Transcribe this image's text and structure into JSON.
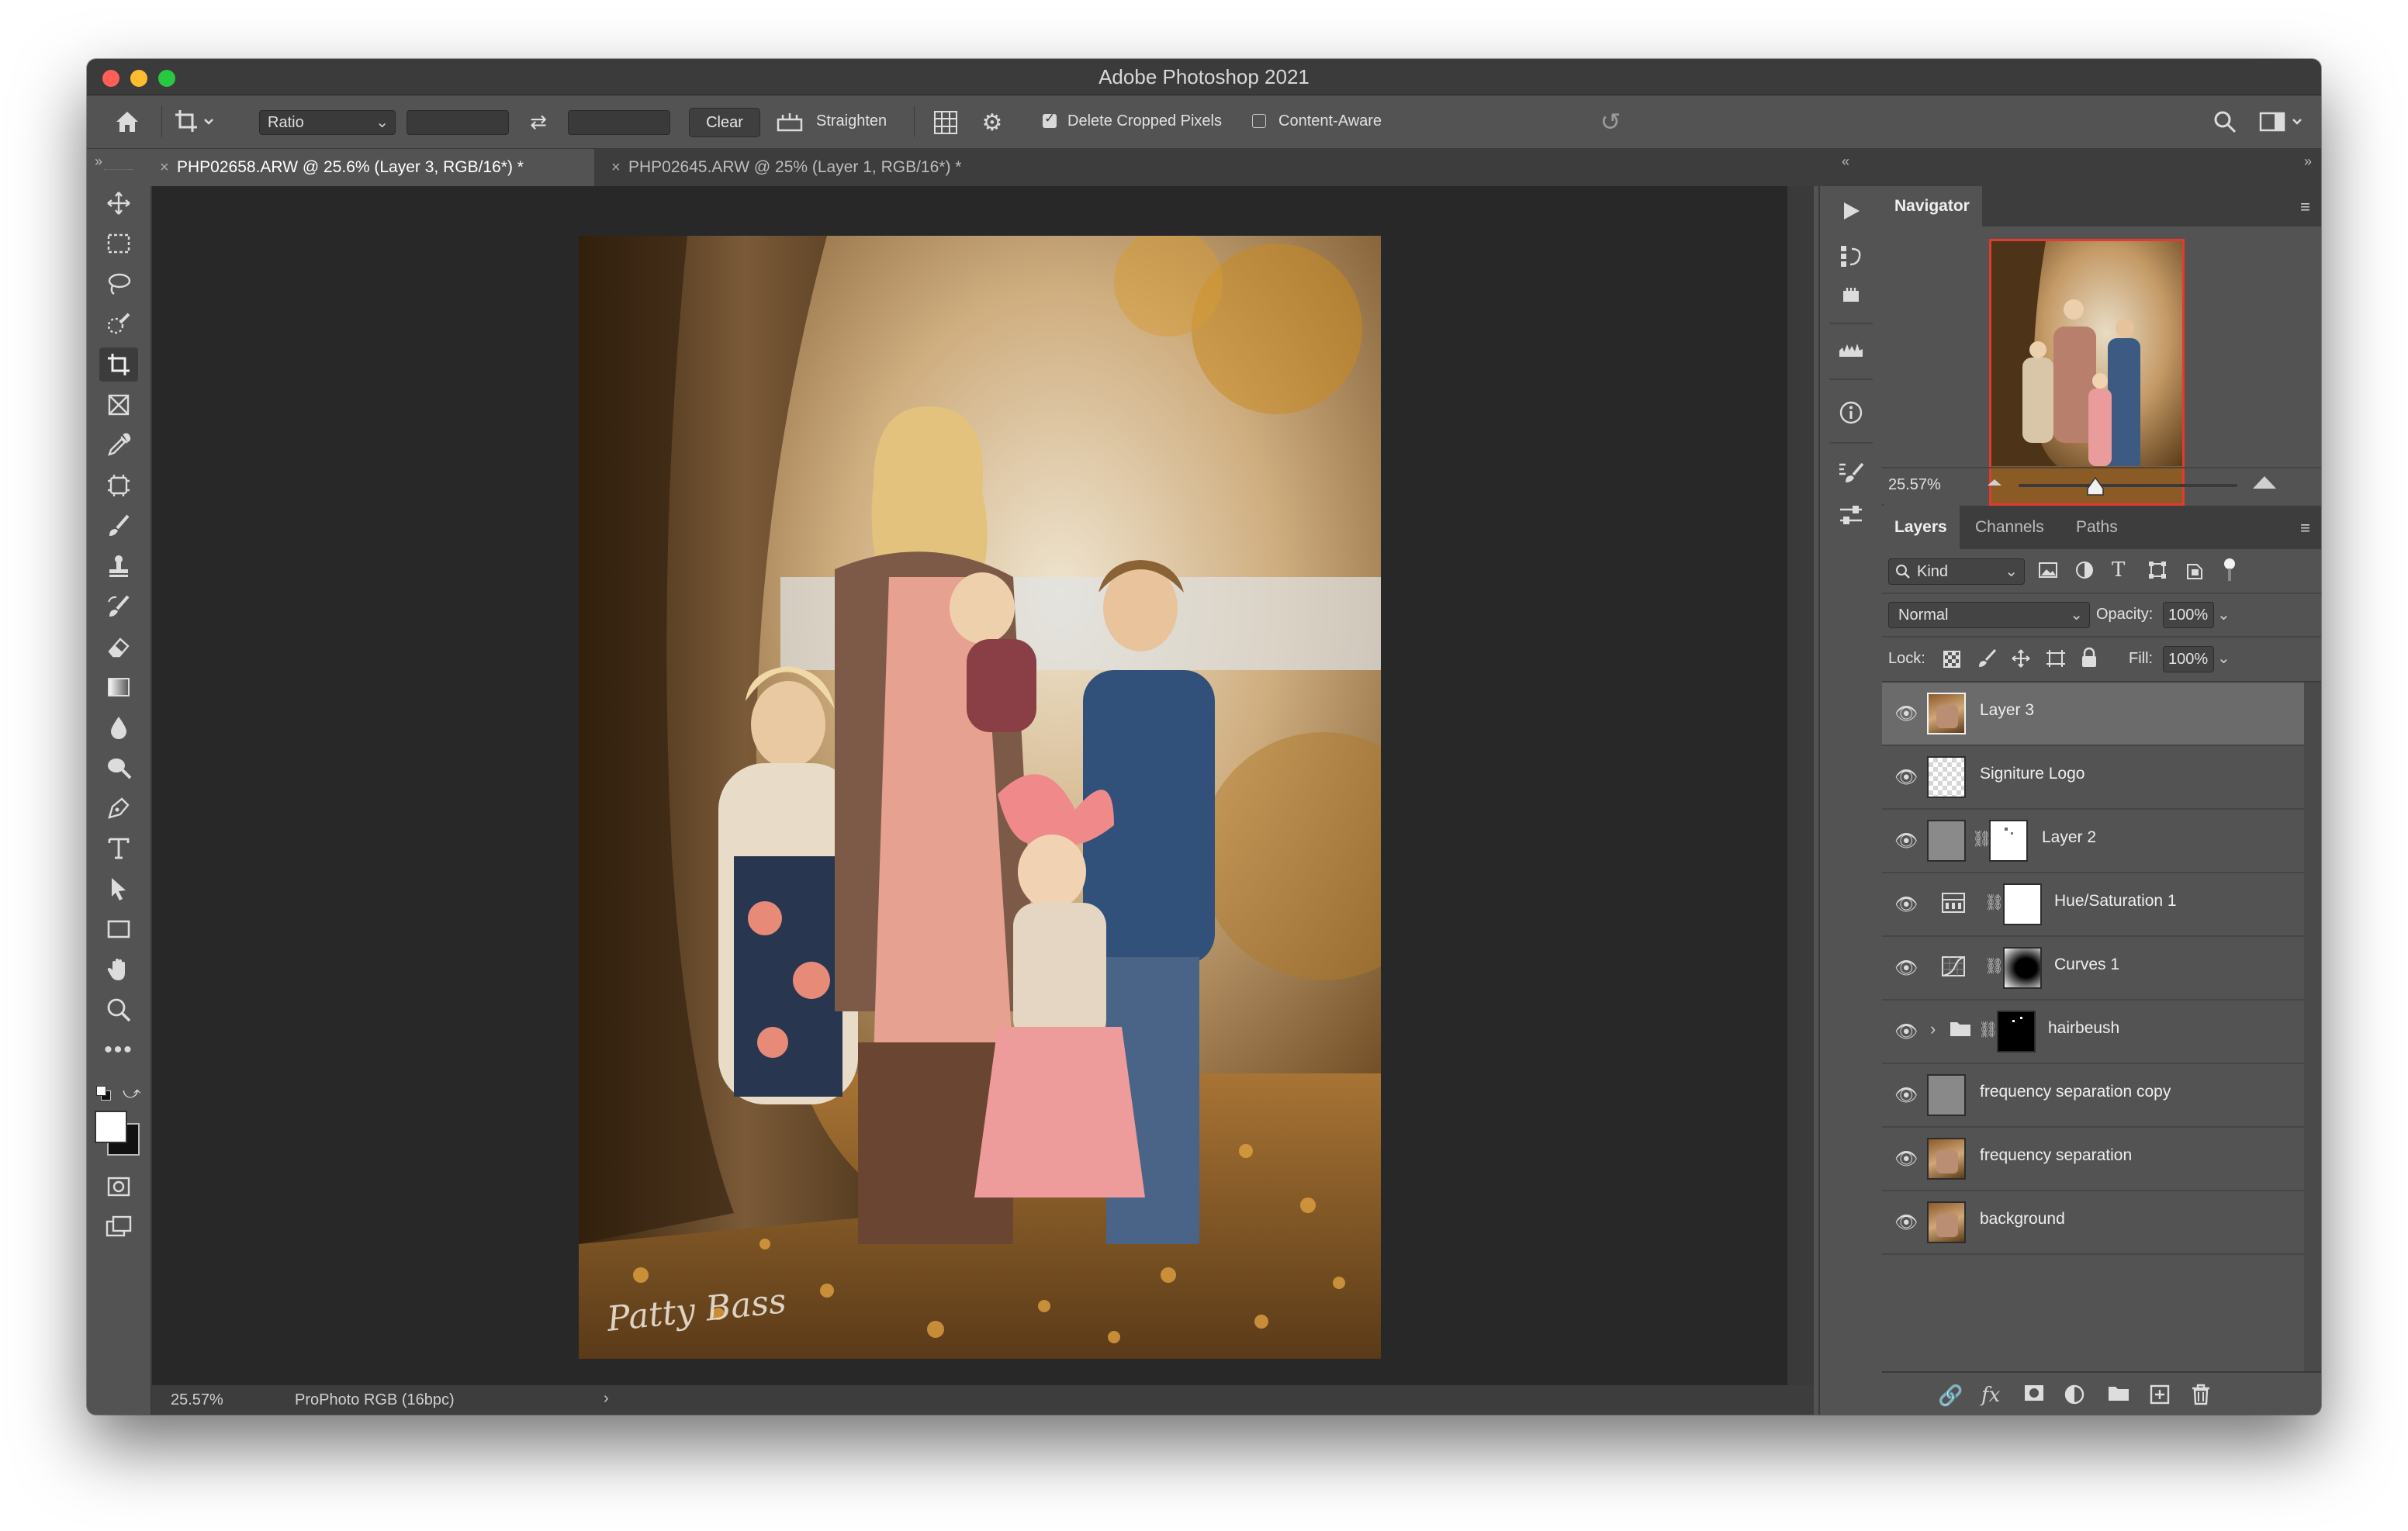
{
  "window": {
    "title": "Adobe Photoshop 2021"
  },
  "options_bar": {
    "ratio_label": "Ratio",
    "clear_label": "Clear",
    "straighten_label": "Straighten",
    "delete_cropped_label": "Delete Cropped Pixels",
    "delete_cropped_checked": true,
    "content_aware_label": "Content-Aware",
    "content_aware_checked": false
  },
  "tabs": [
    {
      "label": "PHP02658.ARW @ 25.6% (Layer 3, RGB/16*) *",
      "active": true
    },
    {
      "label": "PHP02645.ARW @ 25% (Layer 1, RGB/16*) *",
      "active": false
    }
  ],
  "tools": [
    "move-icon",
    "marquee-icon",
    "lasso-icon",
    "quick-select-icon",
    "crop-icon",
    "frame-icon",
    "eyedropper-icon",
    "patch-icon",
    "brush-icon",
    "stamp-icon",
    "history-brush-icon",
    "eraser-icon",
    "gradient-icon",
    "blur-icon",
    "dodge-icon",
    "pen-icon",
    "type-icon",
    "path-select-icon",
    "rectangle-icon",
    "hand-icon",
    "zoom-icon",
    "more-icon"
  ],
  "status": {
    "zoom": "25.57%",
    "profile": "ProPhoto RGB (16bpc)"
  },
  "photo": {
    "signature": "Patty Bass"
  },
  "navigator": {
    "tab": "Navigator",
    "zoom": "25.57%",
    "slider_fraction": 0.35
  },
  "layers_panel": {
    "tabs": [
      "Layers",
      "Channels",
      "Paths"
    ],
    "filter_kind": "Kind",
    "blend_mode": "Normal",
    "opacity_label": "Opacity:",
    "opacity": "100%",
    "lock_label": "Lock:",
    "fill_label": "Fill:",
    "fill": "100%",
    "layers": [
      {
        "name": "Layer 3",
        "selected": true,
        "type": "photo"
      },
      {
        "name": "Signiture Logo",
        "selected": false,
        "type": "transparent"
      },
      {
        "name": "Layer 2",
        "selected": false,
        "type": "gray-mask"
      },
      {
        "name": "Hue/Saturation 1",
        "selected": false,
        "type": "hue-adjust"
      },
      {
        "name": "Curves 1",
        "selected": false,
        "type": "curves-adjust"
      },
      {
        "name": "hairbeush",
        "selected": false,
        "type": "group"
      },
      {
        "name": "frequency separation copy",
        "selected": false,
        "type": "gray"
      },
      {
        "name": "frequency separation",
        "selected": false,
        "type": "photo"
      },
      {
        "name": "background",
        "selected": false,
        "type": "photo"
      }
    ]
  },
  "colors": {
    "accent_red": "#e23b2e",
    "panel_bg": "#535353",
    "canvas_bg": "#282828",
    "selected_layer": "#6b6b6b"
  }
}
